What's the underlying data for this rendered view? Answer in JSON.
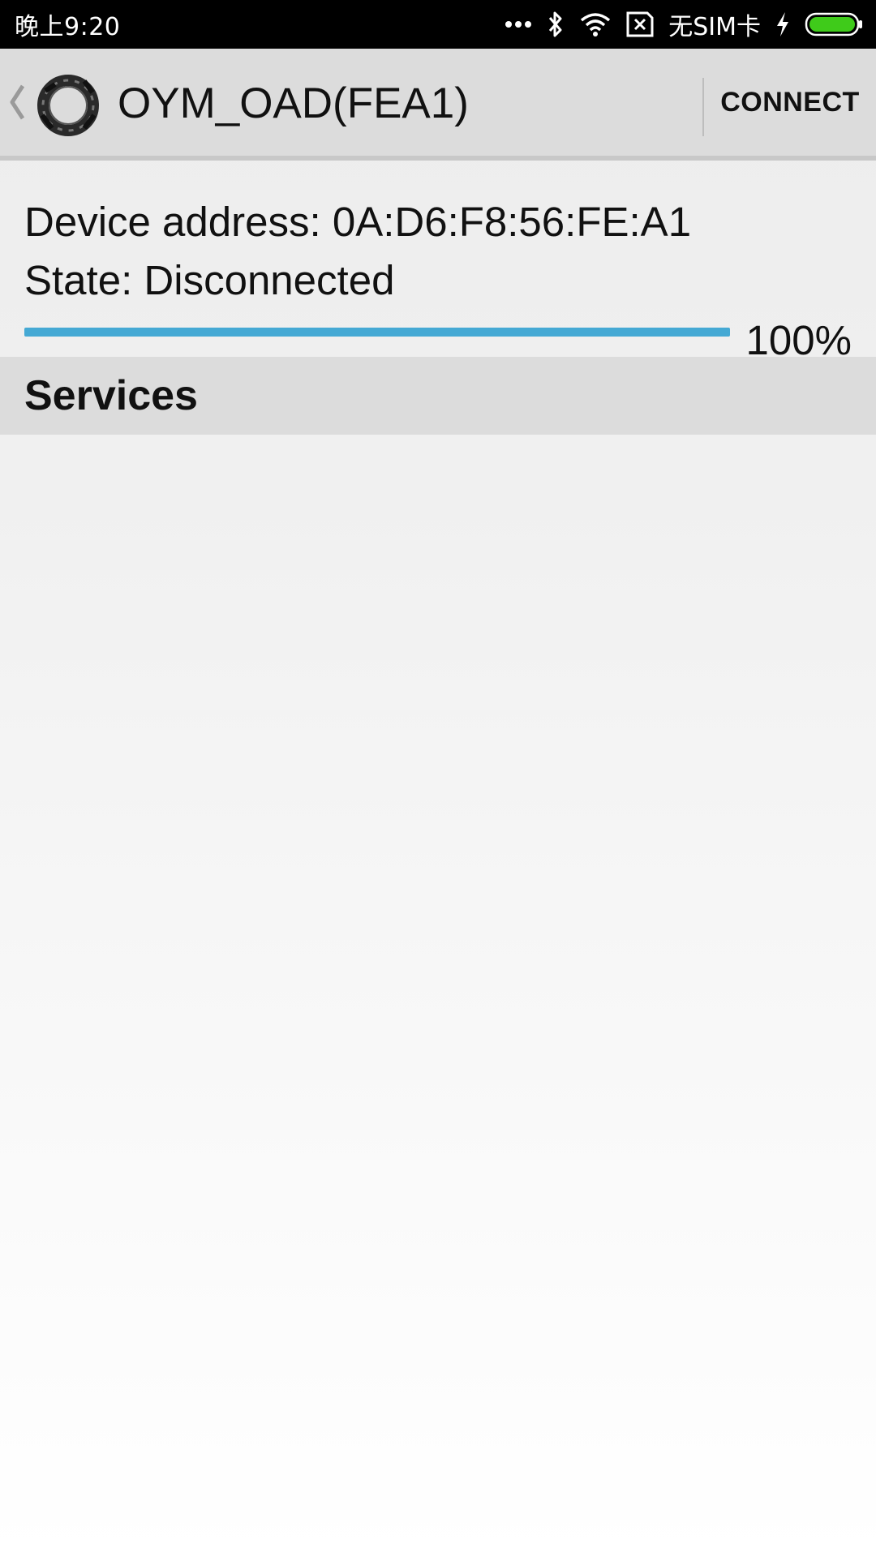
{
  "status_bar": {
    "time": "晚上9:20",
    "carrier": "无SIM卡",
    "icons": [
      "more-dots-icon",
      "bluetooth-icon",
      "wifi-icon",
      "sim-missing-icon",
      "charging-icon",
      "battery-icon"
    ],
    "battery_color": "#3fcb1a"
  },
  "action_bar": {
    "title": "OYM_OAD(FEA1)",
    "connect_label": "CONNECT",
    "icons": [
      "back-chevron-icon",
      "app-logo-icon"
    ]
  },
  "device": {
    "address_line": "Device address: 0A:D6:F8:56:FE:A1",
    "state_line": "State: Disconnected"
  },
  "progress": {
    "value": 1.0,
    "label": "100%",
    "color": "#45a9d4"
  },
  "services": {
    "header": "Services"
  }
}
